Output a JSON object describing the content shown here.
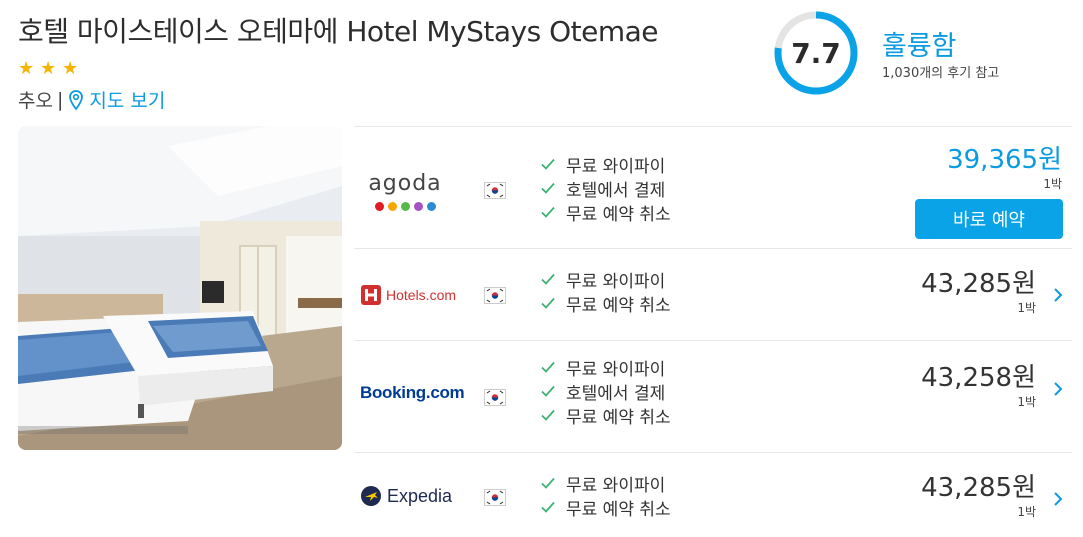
{
  "hotel": {
    "name": "호텔 마이스테이스 오테마에 Hotel MyStays Otemae",
    "star_count": 3,
    "area": "추오",
    "separator": "|",
    "map_link": "지도 보기"
  },
  "rating": {
    "score": "7.7",
    "label": "훌륭함",
    "reviews": "1,030개의 후기 참고",
    "ring_fraction": 0.77,
    "ring_color": "#0aa3e8"
  },
  "offers": [
    {
      "provider": "agoda",
      "features": [
        "무료 와이파이",
        "호텔에서 결제",
        "무료 예약 취소"
      ],
      "price": "39,365원",
      "per_night": "1박",
      "button": "바로 예약",
      "highlight_color": "#0a9be0"
    },
    {
      "provider": "Hotels.com",
      "features": [
        "무료 와이파이",
        "무료 예약 취소"
      ],
      "price": "43,285원",
      "per_night": "1박"
    },
    {
      "provider": "Booking.com",
      "features": [
        "무료 와이파이",
        "호텔에서 결제",
        "무료 예약 취소"
      ],
      "price": "43,258원",
      "per_night": "1박"
    },
    {
      "provider": "Expedia",
      "features": [
        "무료 와이파이",
        "무료 예약 취소"
      ],
      "price": "43,285원",
      "per_night": "1박"
    }
  ],
  "icons": {
    "star": "star-icon",
    "map": "map-pin-icon",
    "check": "check-icon",
    "chevron": "chevron-right-icon",
    "flag": "korea-flag-icon"
  },
  "colors": {
    "accent": "#0a9be0",
    "star": "#f5b400",
    "check": "#3cb371"
  }
}
